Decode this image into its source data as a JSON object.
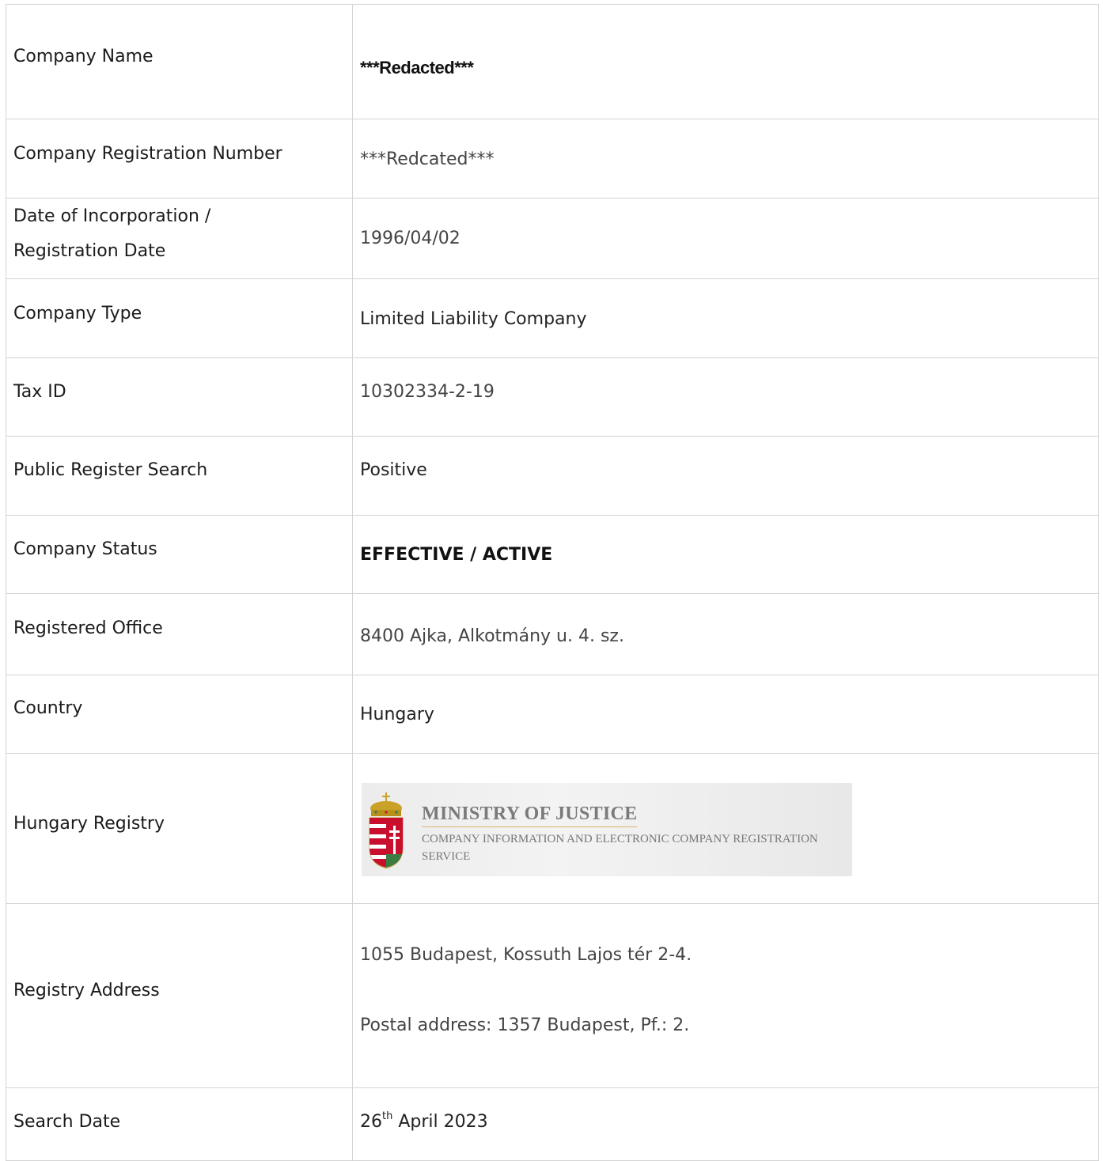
{
  "rows": {
    "company_name": {
      "label": "Company Name",
      "value": "***Redacted***"
    },
    "registration_number": {
      "label": "Company Registration Number",
      "value": "***Redcated***"
    },
    "incorporation_date": {
      "label_line1": "Date of Incorporation /",
      "label_line2": "Registration Date",
      "value": "1996/04/02"
    },
    "company_type": {
      "label": "Company Type",
      "value": "Limited Liability Company"
    },
    "tax_id": {
      "label": "Tax ID",
      "value": "10302334-2-19"
    },
    "public_register_search": {
      "label": "Public Register Search",
      "value": "Positive"
    },
    "company_status": {
      "label": "Company Status",
      "value": "EFFECTIVE / ACTIVE"
    },
    "registered_office": {
      "label": "Registered Office",
      "value": "8400 Ajka, Alkotmány u. 4. sz."
    },
    "country": {
      "label": "Country",
      "value": "Hungary"
    },
    "hungary_registry": {
      "label": "Hungary Registry",
      "banner_title": "MINISTRY OF JUSTICE",
      "banner_subtitle": "COMPANY INFORMATION AND ELECTRONIC COMPANY REGISTRATION SERVICE",
      "crest_icon": "hungarian-coat-of-arms-icon"
    },
    "registry_address": {
      "label": "Registry Address",
      "line1": "1055 Budapest, Kossuth Lajos tér 2-4.",
      "line2": "Postal address: 1357 Budapest, Pf.: 2."
    },
    "search_date": {
      "label": "Search Date",
      "day": "26",
      "ordinal": "th",
      "rest": " April 2023"
    }
  },
  "colors": {
    "border": "#d4d4d4",
    "crest_red": "#c8102e",
    "crest_green": "#3a7d44",
    "crest_gold": "#c9a227"
  }
}
